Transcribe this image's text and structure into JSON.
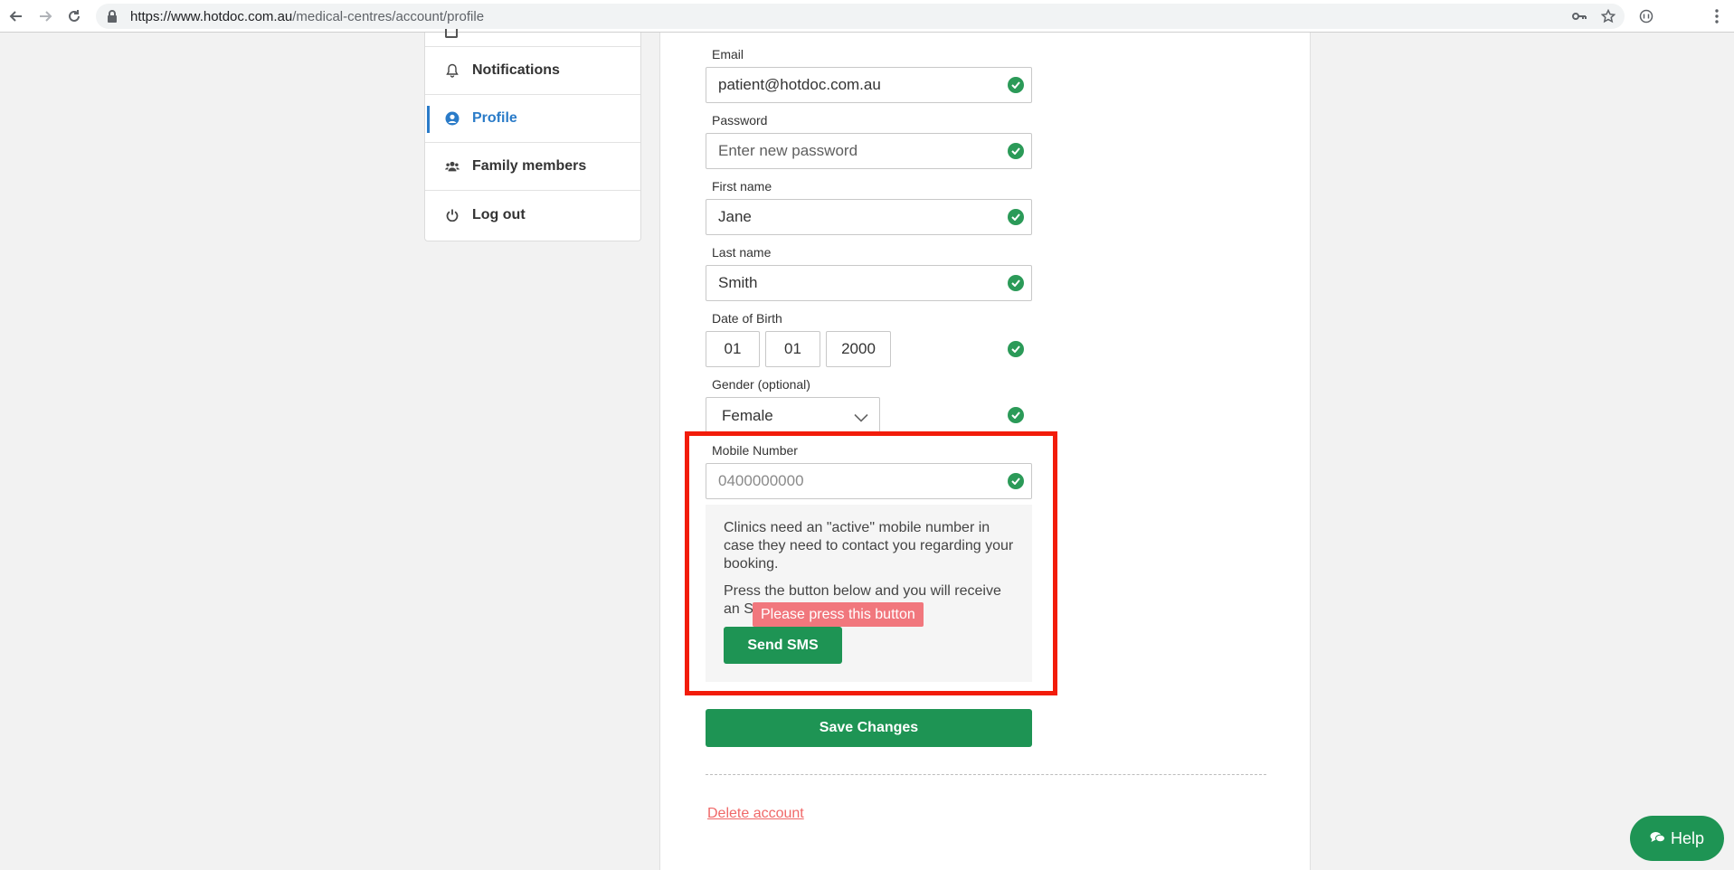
{
  "browser": {
    "url_host": "https://www.hotdoc.com.au",
    "url_path": "/medical-centres/account/profile",
    "icons": [
      "back-icon",
      "forward-icon",
      "reload-icon",
      "lock-icon",
      "key-icon",
      "star-icon",
      "extension-icon",
      "menu-icon"
    ]
  },
  "sidebar": {
    "items": [
      {
        "label": "Notifications",
        "icon": "bell-icon"
      },
      {
        "label": "Profile",
        "icon": "user-circle-icon",
        "active": true
      },
      {
        "label": "Family members",
        "icon": "users-icon"
      },
      {
        "label": "Log out",
        "icon": "power-icon"
      }
    ]
  },
  "form": {
    "email": {
      "label": "Email",
      "value": "patient@hotdoc.com.au"
    },
    "password": {
      "label": "Password",
      "placeholder": "Enter new password"
    },
    "first_name": {
      "label": "First name",
      "value": "Jane"
    },
    "last_name": {
      "label": "Last name",
      "value": "Smith"
    },
    "dob": {
      "label": "Date of Birth",
      "day": "01",
      "month": "01",
      "year": "2000"
    },
    "gender": {
      "label": "Gender (optional)",
      "value": "Female"
    },
    "mobile": {
      "label": "Mobile Number",
      "placeholder": "0400000000"
    },
    "info": {
      "p1": "Clinics need an \"active\" mobile number in case they need to contact you regarding your booking.",
      "p2_visible_start": "Press the button below and you will receive",
      "p2_visible_end": "an S"
    },
    "tooltip": "Please press this button",
    "send_sms": "Send SMS",
    "save_changes": "Save Changes",
    "delete_account": "Delete account"
  },
  "help": {
    "label": "Help"
  },
  "colors": {
    "brand_green": "#1e9454",
    "check_green": "#2b9a58",
    "active_blue": "#2a7bc8",
    "tooltip_red": "#f1777d",
    "highlight_red": "#f21c0a",
    "link_red": "#f06868"
  }
}
